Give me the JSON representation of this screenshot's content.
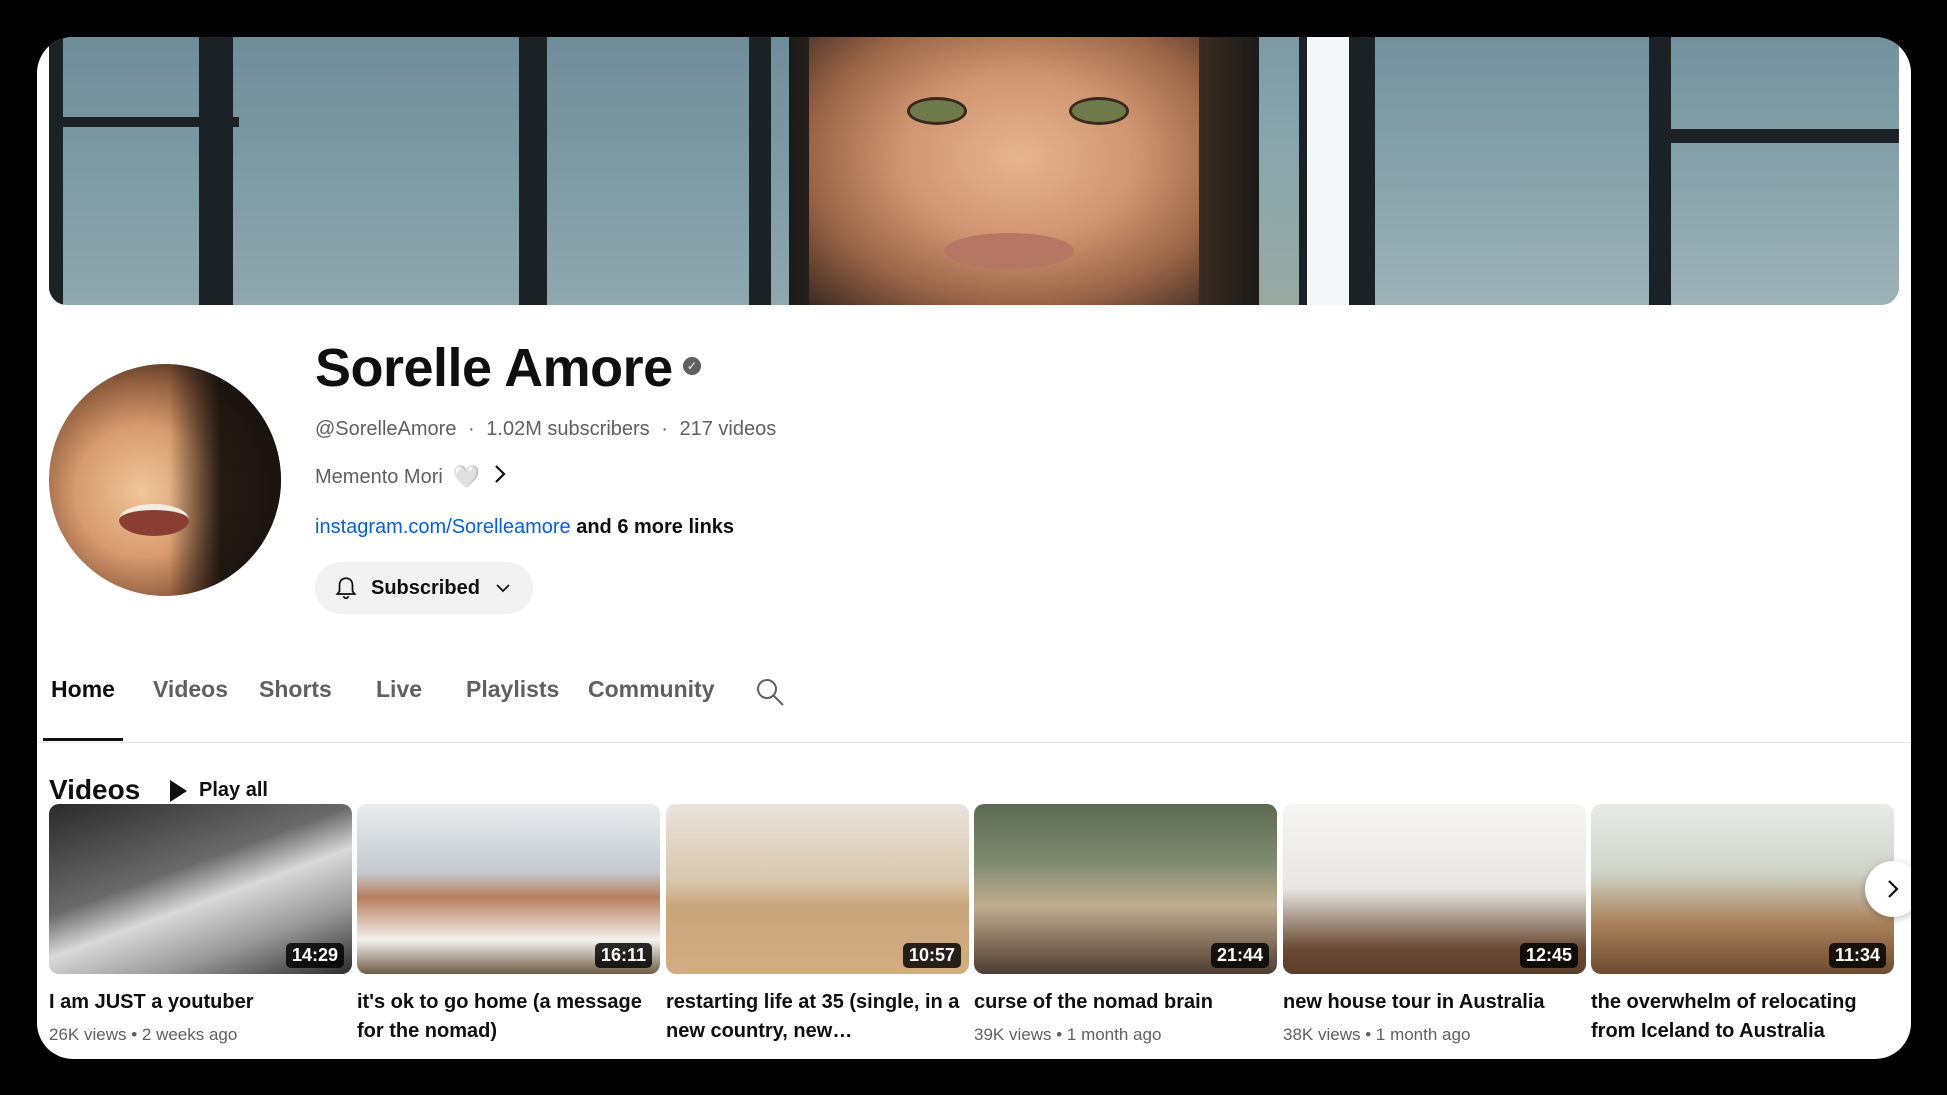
{
  "channel": {
    "name": "Sorelle Amore",
    "verified_label": "✓",
    "handle": "@SorelleAmore",
    "subscribers": "1.02M subscribers",
    "videos_count": "217 videos",
    "separator": "·",
    "description": "Memento Mori",
    "description_emoji": "🤍",
    "link": "instagram.com/Sorelleamore",
    "more_links": "and 6 more links"
  },
  "subscribe": {
    "label": "Subscribed"
  },
  "tabs": [
    {
      "label": "Home",
      "active": true
    },
    {
      "label": "Videos"
    },
    {
      "label": "Shorts"
    },
    {
      "label": "Live"
    },
    {
      "label": "Playlists"
    },
    {
      "label": "Community"
    }
  ],
  "section": {
    "title": "Videos",
    "play_all": "Play all"
  },
  "videos": [
    {
      "title": "I am JUST a youtuber",
      "duration": "14:29",
      "views": "26K views",
      "age": "2 weeks ago"
    },
    {
      "title": "it's ok to go home (a message for the nomad)",
      "duration": "16:11",
      "views": "",
      "age": ""
    },
    {
      "title": "restarting life at 35 (single, in a new country, new…",
      "duration": "10:57",
      "views": "",
      "age": ""
    },
    {
      "title": "curse of the nomad brain",
      "duration": "21:44",
      "views": "39K views",
      "age": "1 month ago"
    },
    {
      "title": "new house tour in Australia",
      "duration": "12:45",
      "views": "38K views",
      "age": "1 month ago"
    },
    {
      "title": "the overwhelm of relocating from Iceland to Australia",
      "duration": "11:34",
      "views": "",
      "age": ""
    }
  ],
  "icons": {
    "verified": "verified-check-icon",
    "chevron_right": "chevron-right-icon",
    "bell": "bell-icon",
    "chevron_down": "chevron-down-icon",
    "search": "search-icon",
    "play": "play-icon",
    "next": "next-arrow-icon"
  },
  "colors": {
    "link": "#065fd4",
    "text": "#0f0f0f",
    "secondary": "#606060",
    "button_bg": "#f2f2f2"
  }
}
